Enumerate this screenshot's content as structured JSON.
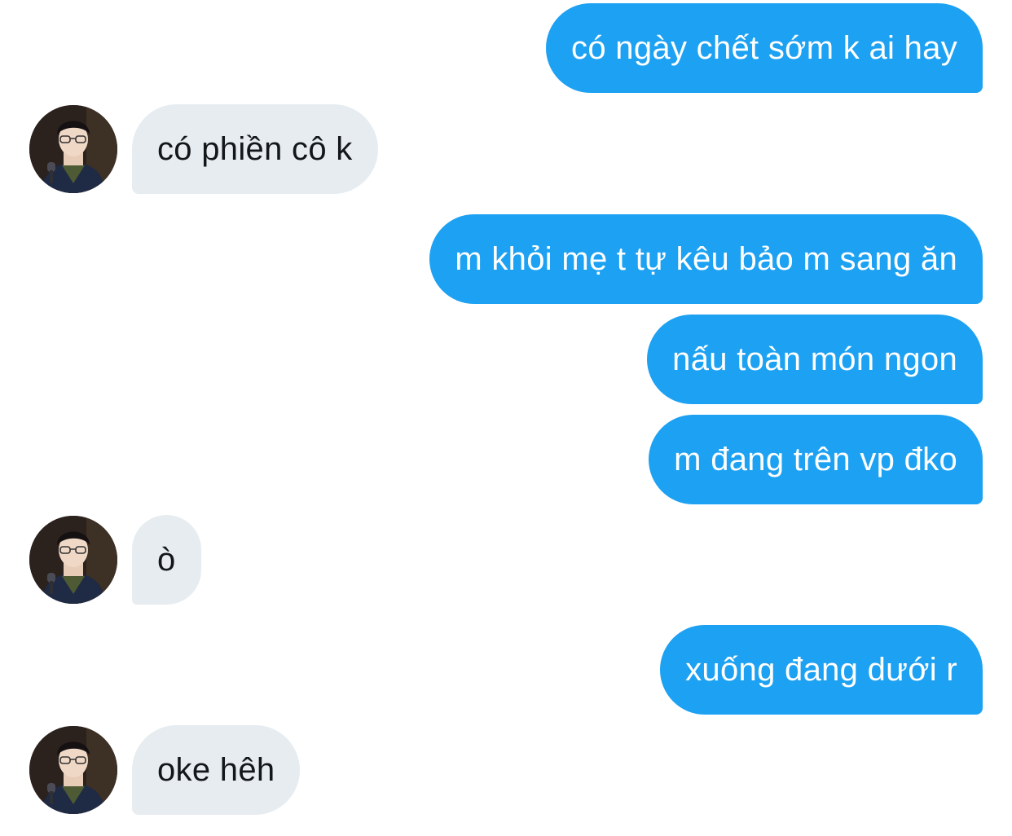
{
  "conversation": {
    "messages": [
      {
        "sender": "me",
        "text": "có ngày chết sớm k ai hay"
      },
      {
        "sender": "contact",
        "text": "có phiền cô k"
      },
      {
        "sender": "me",
        "text": "m khỏi mẹ t tự kêu bảo m sang ăn"
      },
      {
        "sender": "me",
        "text": "nấu toàn món ngon"
      },
      {
        "sender": "me",
        "text": "m đang trên vp đko"
      },
      {
        "sender": "contact",
        "text": "ò"
      },
      {
        "sender": "me",
        "text": "xuống đang dưới r"
      },
      {
        "sender": "contact",
        "text": "oke hêh"
      }
    ]
  },
  "colors": {
    "outgoing_bubble": "#1da1f2",
    "incoming_bubble": "#e6ecf0",
    "outgoing_text": "#ffffff",
    "incoming_text": "#14171a"
  },
  "icons": {
    "avatar": "contact-avatar-photo"
  }
}
